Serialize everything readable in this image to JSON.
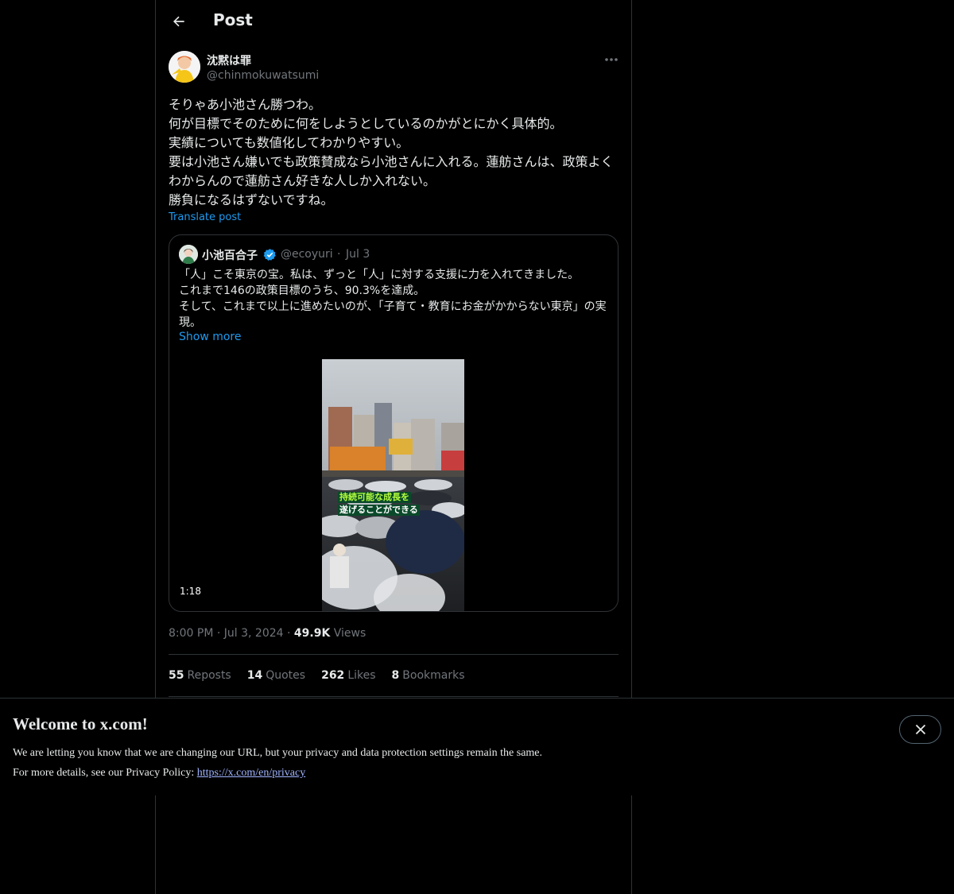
{
  "header": {
    "title": "Post"
  },
  "post": {
    "author_name": "沈黙は罪",
    "author_handle": "@chinmokuwatsumi",
    "text": "そりゃあ小池さん勝つわ。\n何が目標でそのために何をしようとしているのかがとにかく具体的。\n実績についても数値化してわかりやすい。\n要は小池さん嫌いでも政策賛成なら小池さんに入れる。蓮舫さんは、政策よくわからんので蓮舫さん好きな人しか入れない。\n勝負になるはずないですね。",
    "translate_label": "Translate post",
    "time": "8:00 PM",
    "date": "Jul 3, 2024",
    "views_count": "49.9K",
    "views_label": "Views"
  },
  "quote": {
    "author_name": "小池百合子",
    "author_handle": "@ecoyuri",
    "date": "Jul 3",
    "text": "「人」こそ東京の宝。私は、ずっと「人」に対する支援に力を入れてきました。\nこれまで146の政策目標のうち、90.3%を達成。\nそして、これまで以上に進めたいのが、「子育て・教育にお金がかからない東京」の実現。",
    "show_more": "Show more",
    "video_duration": "1:18",
    "video_caption_line1": "持続可能な成長を",
    "video_caption_line2": "遂げることができる"
  },
  "stats": [
    {
      "count": "55",
      "label": "Reposts"
    },
    {
      "count": "14",
      "label": "Quotes"
    },
    {
      "count": "262",
      "label": "Likes"
    },
    {
      "count": "8",
      "label": "Bookmarks"
    }
  ],
  "banner": {
    "title": "Welcome to x.com!",
    "line1": "We are letting you know that we are changing our URL, but your privacy and data protection settings remain the same.",
    "line2_prefix": "For more details, see our Privacy Policy: ",
    "link": "https://x.com/en/privacy"
  },
  "colors": {
    "accent": "#1d9bf0",
    "background": "#000000",
    "border": "#2f3336",
    "muted": "#71767b"
  },
  "icons": {
    "back": "arrow-left-icon",
    "more": "more-horizontal-icon",
    "verified": "verified-badge-icon",
    "close": "close-icon"
  }
}
